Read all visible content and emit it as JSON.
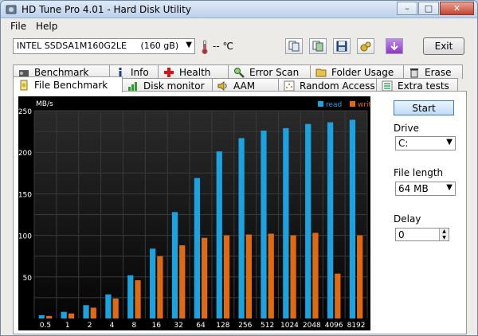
{
  "window": {
    "title": "HD Tune Pro 4.01 - Hard Disk Utility",
    "minimize_label": "–",
    "maximize_label": "□",
    "close_label": "✕"
  },
  "menu": {
    "file": "File",
    "help": "Help"
  },
  "toolbar": {
    "drive": "INTEL SSDSA1M160G2LE",
    "drive_size": "(160 gB)",
    "temperature": "-- ℃",
    "exit_label": "Exit",
    "icons": [
      "copy-text-icon",
      "copy-screenshot-icon",
      "save-icon",
      "options-icon",
      "download-icon"
    ]
  },
  "tabs_top": [
    {
      "label": "Benchmark",
      "icon": "benchmark-icon"
    },
    {
      "label": "Info",
      "icon": "info-icon"
    },
    {
      "label": "Health",
      "icon": "health-icon"
    },
    {
      "label": "Error Scan",
      "icon": "error-scan-icon"
    },
    {
      "label": "Folder Usage",
      "icon": "folder-icon"
    },
    {
      "label": "Erase",
      "icon": "erase-icon"
    }
  ],
  "tabs_bottom": [
    {
      "label": "File Benchmark",
      "icon": "file-benchmark-icon",
      "active": true
    },
    {
      "label": "Disk monitor",
      "icon": "disk-monitor-icon"
    },
    {
      "label": "AAM",
      "icon": "aam-icon"
    },
    {
      "label": "Random Access",
      "icon": "random-access-icon"
    },
    {
      "label": "Extra tests",
      "icon": "extra-tests-icon"
    }
  ],
  "controls": {
    "start_label": "Start",
    "drive_label": "Drive",
    "drive_value": "C:",
    "file_length_label": "File length",
    "file_length_value": "64 MB",
    "delay_label": "Delay",
    "delay_value": "0"
  },
  "colors": {
    "read": "#1aa3e0",
    "write": "#e06a12",
    "chart_bg": "#0b0b0b"
  },
  "chart_data": {
    "type": "bar",
    "ylabel": "MB/s",
    "ylim": [
      0,
      250
    ],
    "yticks": [
      50,
      100,
      150,
      200,
      250
    ],
    "categories": [
      "0.5",
      "1",
      "2",
      "4",
      "8",
      "16",
      "32",
      "64",
      "128",
      "256",
      "512",
      "1024",
      "2048",
      "4096",
      "8192"
    ],
    "series": [
      {
        "name": "read",
        "values": [
          4,
          8,
          16,
          29,
          52,
          84,
          128,
          169,
          201,
          217,
          226,
          229,
          234,
          236,
          239
        ]
      },
      {
        "name": "write",
        "values": [
          3,
          6,
          13,
          24,
          46,
          75,
          88,
          97,
          100,
          101,
          102,
          100,
          103,
          54,
          100
        ]
      }
    ],
    "legend_position": "top-right",
    "grid": true
  }
}
